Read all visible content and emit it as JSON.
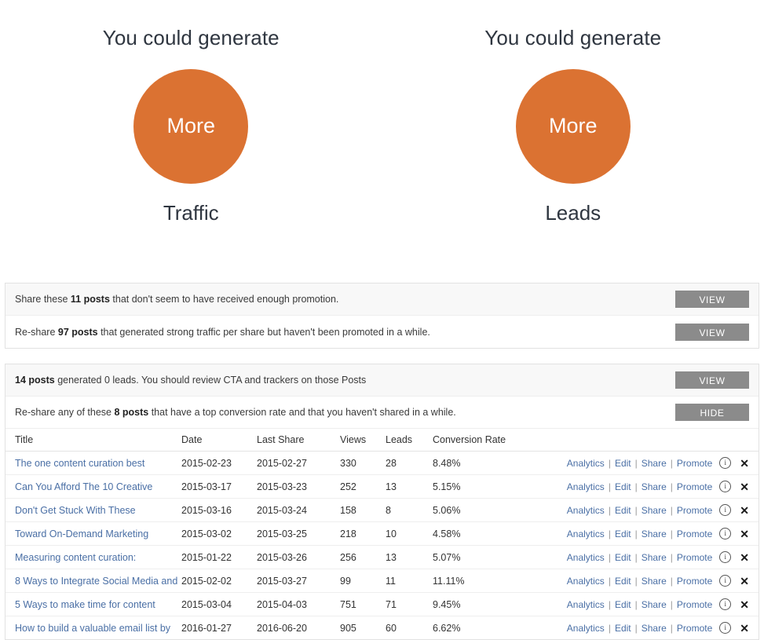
{
  "theme": {
    "accent_orange": "#db7232",
    "button_grey": "#8b8b8b",
    "link_blue": "#4a6fa5"
  },
  "hero": {
    "promos": [
      {
        "heading": "You could generate",
        "circle_label": "More",
        "footer": "Traffic",
        "icon": "circle-shape"
      },
      {
        "heading": "You could generate",
        "circle_label": "More",
        "footer": "Leads",
        "icon": "circle-shape"
      }
    ]
  },
  "suggestions_panel": {
    "rows": [
      {
        "text_before": "Share these ",
        "text_bold": "11 posts",
        "text_after": " that don't seem to have received enough promotion.",
        "button": "VIEW"
      },
      {
        "text_before": "Re-share ",
        "text_bold": "97 posts",
        "text_after": " that generated strong traffic per share but haven't been promoted in a while.",
        "button": "VIEW"
      }
    ]
  },
  "leads_panel": {
    "rows": [
      {
        "text_before": "",
        "text_bold": "14 posts",
        "text_after": " generated 0 leads. You should review CTA and trackers on those Posts",
        "button": "VIEW"
      },
      {
        "text_before": "Re-share any of these ",
        "text_bold": "8 posts",
        "text_after": " that have a top conversion rate and that you haven't shared in a while.",
        "button": "HIDE"
      }
    ],
    "table": {
      "headers": {
        "title": "Title",
        "date": "Date",
        "last_share": "Last Share",
        "views": "Views",
        "leads": "Leads",
        "conversion_rate": "Conversion Rate"
      },
      "row_actions": {
        "analytics": "Analytics",
        "edit": "Edit",
        "share": "Share",
        "promote": "Promote",
        "separator": "|",
        "info_icon": "info-circle-icon",
        "info_glyph": "i",
        "close_icon": "close-x-icon",
        "close_glyph": "✕"
      },
      "rows": [
        {
          "title": "The one content curation best",
          "date": "2015-02-23",
          "last_share": "2015-02-27",
          "views": "330",
          "leads": "28",
          "conversion_rate": "8.48%"
        },
        {
          "title": "Can You Afford The 10 Creative",
          "date": "2015-03-17",
          "last_share": "2015-03-23",
          "views": "252",
          "leads": "13",
          "conversion_rate": "5.15%"
        },
        {
          "title": "Don't Get Stuck With These",
          "date": "2015-03-16",
          "last_share": "2015-03-24",
          "views": "158",
          "leads": "8",
          "conversion_rate": "5.06%"
        },
        {
          "title": "Toward On-Demand Marketing",
          "date": "2015-03-02",
          "last_share": "2015-03-25",
          "views": "218",
          "leads": "10",
          "conversion_rate": "4.58%"
        },
        {
          "title": "Measuring content curation:",
          "date": "2015-01-22",
          "last_share": "2015-03-26",
          "views": "256",
          "leads": "13",
          "conversion_rate": "5.07%"
        },
        {
          "title": "8 Ways to Integrate Social Media and",
          "date": "2015-02-02",
          "last_share": "2015-03-27",
          "views": "99",
          "leads": "11",
          "conversion_rate": "11.11%"
        },
        {
          "title": "5 Ways to make time for content",
          "date": "2015-03-04",
          "last_share": "2015-04-03",
          "views": "751",
          "leads": "71",
          "conversion_rate": "9.45%"
        },
        {
          "title": "How to build a valuable email list by",
          "date": "2016-01-27",
          "last_share": "2016-06-20",
          "views": "905",
          "leads": "60",
          "conversion_rate": "6.62%"
        }
      ]
    }
  }
}
